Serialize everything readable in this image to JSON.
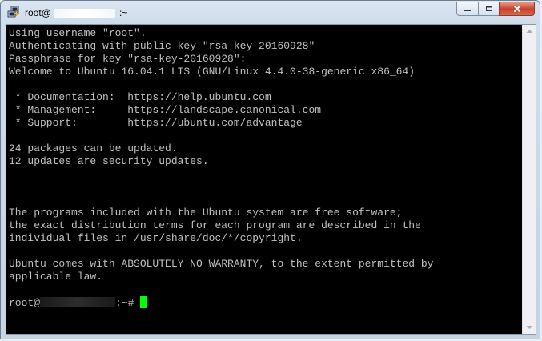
{
  "window": {
    "title_user": "root@",
    "title_suffix": ":~"
  },
  "terminal": {
    "lines": [
      "Using username \"root\".",
      "Authenticating with public key \"rsa-key-20160928\"",
      "Passphrase for key \"rsa-key-20160928\":",
      "Welcome to Ubuntu 16.04.1 LTS (GNU/Linux 4.4.0-38-generic x86_64)",
      "",
      " * Documentation:  https://help.ubuntu.com",
      " * Management:     https://landscape.canonical.com",
      " * Support:        https://ubuntu.com/advantage",
      "",
      "24 packages can be updated.",
      "12 updates are security updates.",
      "",
      "",
      "",
      "The programs included with the Ubuntu system are free software;",
      "the exact distribution terms for each program are described in the",
      "individual files in /usr/share/doc/*/copyright.",
      "",
      "Ubuntu comes with ABSOLUTELY NO WARRANTY, to the extent permitted by",
      "applicable law.",
      ""
    ],
    "prompt_user": "root@",
    "prompt_suffix": ":~#",
    "cursor_color": "#00ff00",
    "text_color": "#c0c0c0",
    "background_color": "#000000"
  },
  "icons": {
    "app": "putty-icon",
    "minimize": "minimize-icon",
    "maximize": "maximize-icon",
    "close": "close-icon",
    "scroll_up": "scroll-up-icon",
    "scroll_down": "scroll-down-icon"
  }
}
